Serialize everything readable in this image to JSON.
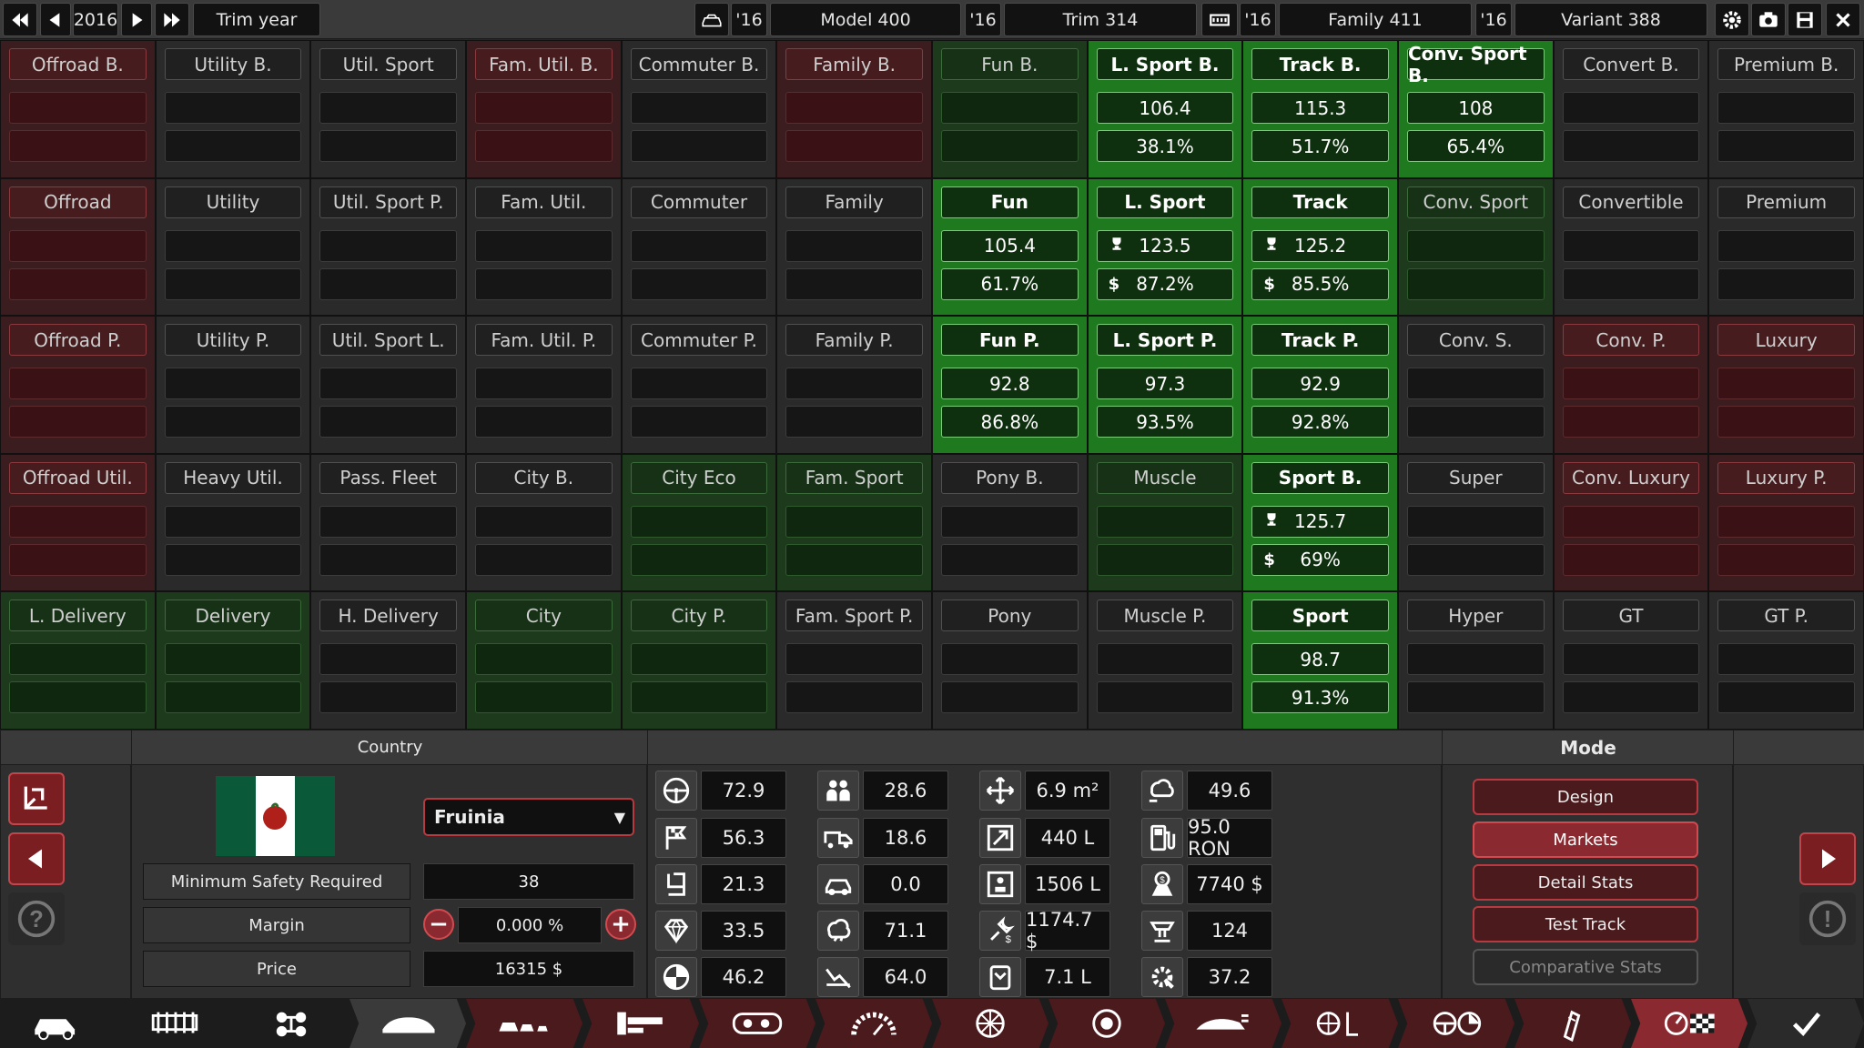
{
  "topbar": {
    "year": "2016",
    "trim_year_label": "Trim year",
    "model_year": "'16",
    "model_name": "Model 400",
    "trim_year": "'16",
    "trim_name": "Trim 314",
    "family_year": "'16",
    "family_name": "Family 411",
    "variant_year": "'16",
    "variant_name": "Variant 388"
  },
  "markets": [
    [
      {
        "name": "Offroad B.",
        "style": "red",
        "v1": "",
        "v2": ""
      },
      {
        "name": "Utility B.",
        "style": "gray",
        "v1": "",
        "v2": ""
      },
      {
        "name": "Util. Sport",
        "style": "gray",
        "v1": "",
        "v2": ""
      },
      {
        "name": "Fam. Util. B.",
        "style": "red",
        "v1": "",
        "v2": ""
      },
      {
        "name": "Commuter B.",
        "style": "gray",
        "v1": "",
        "v2": ""
      },
      {
        "name": "Family B.",
        "style": "red",
        "v1": "",
        "v2": ""
      },
      {
        "name": "Fun B.",
        "style": "dgreen",
        "v1": "",
        "v2": ""
      },
      {
        "name": "L. Sport B.",
        "style": "green",
        "v1": "106.4",
        "v2": "38.1%"
      },
      {
        "name": "Track B.",
        "style": "green",
        "v1": "115.3",
        "v2": "51.7%"
      },
      {
        "name": "Conv. Sport B.",
        "style": "green",
        "v1": "108",
        "v2": "65.4%"
      },
      {
        "name": "Convert B.",
        "style": "gray",
        "v1": "",
        "v2": ""
      },
      {
        "name": "Premium B.",
        "style": "gray",
        "v1": "",
        "v2": ""
      }
    ],
    [
      {
        "name": "Offroad",
        "style": "red",
        "v1": "",
        "v2": ""
      },
      {
        "name": "Utility",
        "style": "gray",
        "v1": "",
        "v2": ""
      },
      {
        "name": "Util. Sport P.",
        "style": "gray",
        "v1": "",
        "v2": ""
      },
      {
        "name": "Fam. Util.",
        "style": "gray",
        "v1": "",
        "v2": ""
      },
      {
        "name": "Commuter",
        "style": "gray",
        "v1": "",
        "v2": ""
      },
      {
        "name": "Family",
        "style": "gray",
        "v1": "",
        "v2": ""
      },
      {
        "name": "Fun",
        "style": "green",
        "v1": "105.4",
        "v2": "61.7%"
      },
      {
        "name": "L. Sport",
        "style": "green",
        "v1": "123.5",
        "v2": "87.2%",
        "icons": true
      },
      {
        "name": "Track",
        "style": "green",
        "v1": "125.2",
        "v2": "85.5%",
        "icons": true
      },
      {
        "name": "Conv. Sport",
        "style": "dgreen",
        "v1": "",
        "v2": ""
      },
      {
        "name": "Convertible",
        "style": "gray",
        "v1": "",
        "v2": ""
      },
      {
        "name": "Premium",
        "style": "gray",
        "v1": "",
        "v2": ""
      }
    ],
    [
      {
        "name": "Offroad P.",
        "style": "red",
        "v1": "",
        "v2": ""
      },
      {
        "name": "Utility P.",
        "style": "gray",
        "v1": "",
        "v2": ""
      },
      {
        "name": "Util. Sport L.",
        "style": "gray",
        "v1": "",
        "v2": ""
      },
      {
        "name": "Fam. Util. P.",
        "style": "gray",
        "v1": "",
        "v2": ""
      },
      {
        "name": "Commuter P.",
        "style": "gray",
        "v1": "",
        "v2": ""
      },
      {
        "name": "Family P.",
        "style": "gray",
        "v1": "",
        "v2": ""
      },
      {
        "name": "Fun P.",
        "style": "green",
        "v1": "92.8",
        "v2": "86.8%"
      },
      {
        "name": "L. Sport P.",
        "style": "green",
        "v1": "97.3",
        "v2": "93.5%"
      },
      {
        "name": "Track P.",
        "style": "green",
        "v1": "92.9",
        "v2": "92.8%"
      },
      {
        "name": "Conv. S.",
        "style": "gray",
        "v1": "",
        "v2": ""
      },
      {
        "name": "Conv. P.",
        "style": "red",
        "v1": "",
        "v2": ""
      },
      {
        "name": "Luxury",
        "style": "red",
        "v1": "",
        "v2": ""
      }
    ],
    [
      {
        "name": "Offroad Util.",
        "style": "red",
        "v1": "",
        "v2": ""
      },
      {
        "name": "Heavy Util.",
        "style": "gray",
        "v1": "",
        "v2": ""
      },
      {
        "name": "Pass. Fleet",
        "style": "gray",
        "v1": "",
        "v2": ""
      },
      {
        "name": "City B.",
        "style": "gray",
        "v1": "",
        "v2": ""
      },
      {
        "name": "City Eco",
        "style": "dgreen",
        "v1": "",
        "v2": ""
      },
      {
        "name": "Fam. Sport",
        "style": "dgreen",
        "v1": "",
        "v2": ""
      },
      {
        "name": "Pony B.",
        "style": "gray",
        "v1": "",
        "v2": ""
      },
      {
        "name": "Muscle",
        "style": "dgreen",
        "v1": "",
        "v2": ""
      },
      {
        "name": "Sport B.",
        "style": "green",
        "v1": "125.7",
        "v2": "69%",
        "icons": true
      },
      {
        "name": "Super",
        "style": "gray",
        "v1": "",
        "v2": ""
      },
      {
        "name": "Conv. Luxury",
        "style": "red",
        "v1": "",
        "v2": ""
      },
      {
        "name": "Luxury P.",
        "style": "red",
        "v1": "",
        "v2": ""
      }
    ],
    [
      {
        "name": "L. Delivery",
        "style": "dgreen",
        "v1": "",
        "v2": ""
      },
      {
        "name": "Delivery",
        "style": "dgreen",
        "v1": "",
        "v2": ""
      },
      {
        "name": "H. Delivery",
        "style": "gray",
        "v1": "",
        "v2": ""
      },
      {
        "name": "City",
        "style": "dgreen",
        "v1": "",
        "v2": ""
      },
      {
        "name": "City P.",
        "style": "dgreen",
        "v1": "",
        "v2": ""
      },
      {
        "name": "Fam. Sport P.",
        "style": "gray",
        "v1": "",
        "v2": ""
      },
      {
        "name": "Pony",
        "style": "gray",
        "v1": "",
        "v2": ""
      },
      {
        "name": "Muscle P.",
        "style": "gray",
        "v1": "",
        "v2": ""
      },
      {
        "name": "Sport",
        "style": "green",
        "v1": "98.7",
        "v2": "91.3%"
      },
      {
        "name": "Hyper",
        "style": "gray",
        "v1": "",
        "v2": ""
      },
      {
        "name": "GT",
        "style": "gray",
        "v1": "",
        "v2": ""
      },
      {
        "name": "GT P.",
        "style": "gray",
        "v1": "",
        "v2": ""
      }
    ]
  ],
  "country": {
    "header": "Country",
    "selected": "Fruinia",
    "min_safety_label": "Minimum Safety Required",
    "min_safety_value": "38",
    "margin_label": "Margin",
    "margin_value": "0.000 %",
    "price_label": "Price",
    "price_value": "16315 $"
  },
  "stats": [
    {
      "icon": "steering-wheel-icon",
      "value": "72.9"
    },
    {
      "icon": "finish-flag-icon",
      "value": "56.3"
    },
    {
      "icon": "seat-icon",
      "value": "21.3"
    },
    {
      "icon": "diamond-icon",
      "value": "33.5"
    },
    {
      "icon": "crash-test-icon",
      "value": "46.2"
    },
    {
      "icon": "passengers-icon",
      "value": "28.6"
    },
    {
      "icon": "utility-truck-icon",
      "value": "18.6"
    },
    {
      "icon": "offroad-icon",
      "value": "0.0"
    },
    {
      "icon": "environment-icon",
      "value": "71.1"
    },
    {
      "icon": "service-icon",
      "value": "64.0"
    },
    {
      "icon": "footprint-icon",
      "value": "6.9 m²"
    },
    {
      "icon": "cargo-volume-icon",
      "value": "440 L"
    },
    {
      "icon": "passenger-volume-icon",
      "value": "1506 L"
    },
    {
      "icon": "service-cost-icon",
      "value": "1174.7 $"
    },
    {
      "icon": "fuel-economy-icon",
      "value": "7.1 L"
    },
    {
      "icon": "emissions-icon",
      "value": "49.6"
    },
    {
      "icon": "fuel-type-icon",
      "value": "95.0 RON"
    },
    {
      "icon": "cost-icon",
      "value": "7740 $"
    },
    {
      "icon": "manufacturing-icon",
      "value": "124"
    },
    {
      "icon": "engineering-icon",
      "value": "37.2"
    }
  ],
  "mode": {
    "header": "Mode",
    "buttons": [
      "Design",
      "Markets",
      "Detail Stats",
      "Test Track",
      "Comparative Stats"
    ]
  },
  "nav_icons": [
    "car-body-icon",
    "chassis-icon",
    "suspension-icon",
    "body-icon",
    "trim-icon",
    "interior-icon",
    "engine-icon",
    "gauge-icon",
    "wheel-icon",
    "brake-icon",
    "aero-icon",
    "fixtures-icon",
    "steering-icon",
    "paint-icon",
    "test-icon",
    "finish-icon"
  ],
  "colors": {
    "accent_green": "#1f7a1f",
    "accent_red": "#b83a40",
    "modebtn_active": "#8a2a30"
  }
}
